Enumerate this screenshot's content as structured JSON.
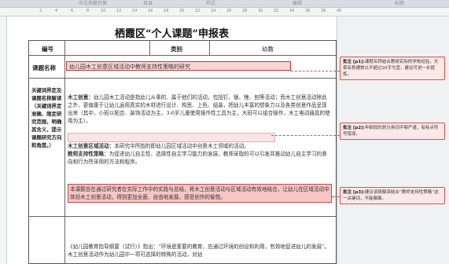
{
  "ribbon": {
    "labels": [
      "中文简繁转换",
      "目录",
      "样式",
      "编辑",
      "标题"
    ]
  },
  "ruler": {
    "numbers": [
      "2",
      "4",
      "6",
      "8",
      "10",
      "12",
      "14",
      "16",
      "18",
      "20",
      "22",
      "24",
      "26",
      "28",
      "30",
      "32",
      "34",
      "36",
      "38",
      "40"
    ]
  },
  "document": {
    "title": "栖霞区“个人课题”申报表",
    "row1": {
      "label_no": "编号",
      "label_category": "类别",
      "category_value": "幼教"
    },
    "row2": {
      "label": "课题名称",
      "topic": "幼儿园木工创意区域活动中教师支持性策略的研究"
    },
    "row3": {
      "label": "关键词界定及课题名称解读（关键词界定准确、限定研究范围，明确其含义，提示课题研究方向和角度。）",
      "p1_lead": "木工创意：",
      "p1": "幼儿园木工活动是指幼儿从事的、属于他们的活动，包括钉、锯、锉、刨等活动；而木工创意活动除此之外，更偏重于让幼儿运用真实的木材进行设计、构思、上色、组装，把幼儿丰富的想象力以及各类创意作品呈现出来（其中，小班以粘合、装饰活动为主，3-6岁儿童使用操作性工具为主，大班可以组合操作，木工电动器具的使用为主）。",
      "p2_lead": "木工创意区域活动：",
      "p2": "本研究中所指的即幼儿园区域活动中创意木工领域的活动。",
      "p3_lead": "教师支持性策略：",
      "p3": "为促进幼儿自主性、选择性自主学习能力的发展，教师采取的可以引发并推动幼儿自主学习的意向和行为所采用的方法和程序。",
      "p4": "本课题旨在通过研究者在实际工作中的实践与总结，将木工创意活动与区域活动有效地结合，让幼儿在区域活动中体验木工创意活动，得到更加全面、自由地发展，感受创作的愉悦。"
    },
    "row5": {
      "p1": "《幼儿园教育指导纲要（试行）》指出：“环境是重要的教育，应通过环境的创设和利用，有效地促进幼儿的发展”。木工创意活动作为幼儿园中一项可选择的特殊的活动，对幼"
    }
  },
  "comments": [
    {
      "label": "批注 [p1]:",
      "text": "课题名称结合教研实际的学校经验，文章名称通常以不超过20字为宜，建议可进一步提炼。"
    },
    {
      "label": "批注 [p2]:",
      "text": "年龄段的划分用词不够严谨，有标点符号错误。"
    },
    {
      "label": "批注 [p3]:",
      "text": "建议该段解读结合“教师支持性策略”这一关键词，不能偏离。"
    }
  ],
  "colors": {
    "comment_border": "#d9534f",
    "highlight": "#f6c6c6"
  }
}
